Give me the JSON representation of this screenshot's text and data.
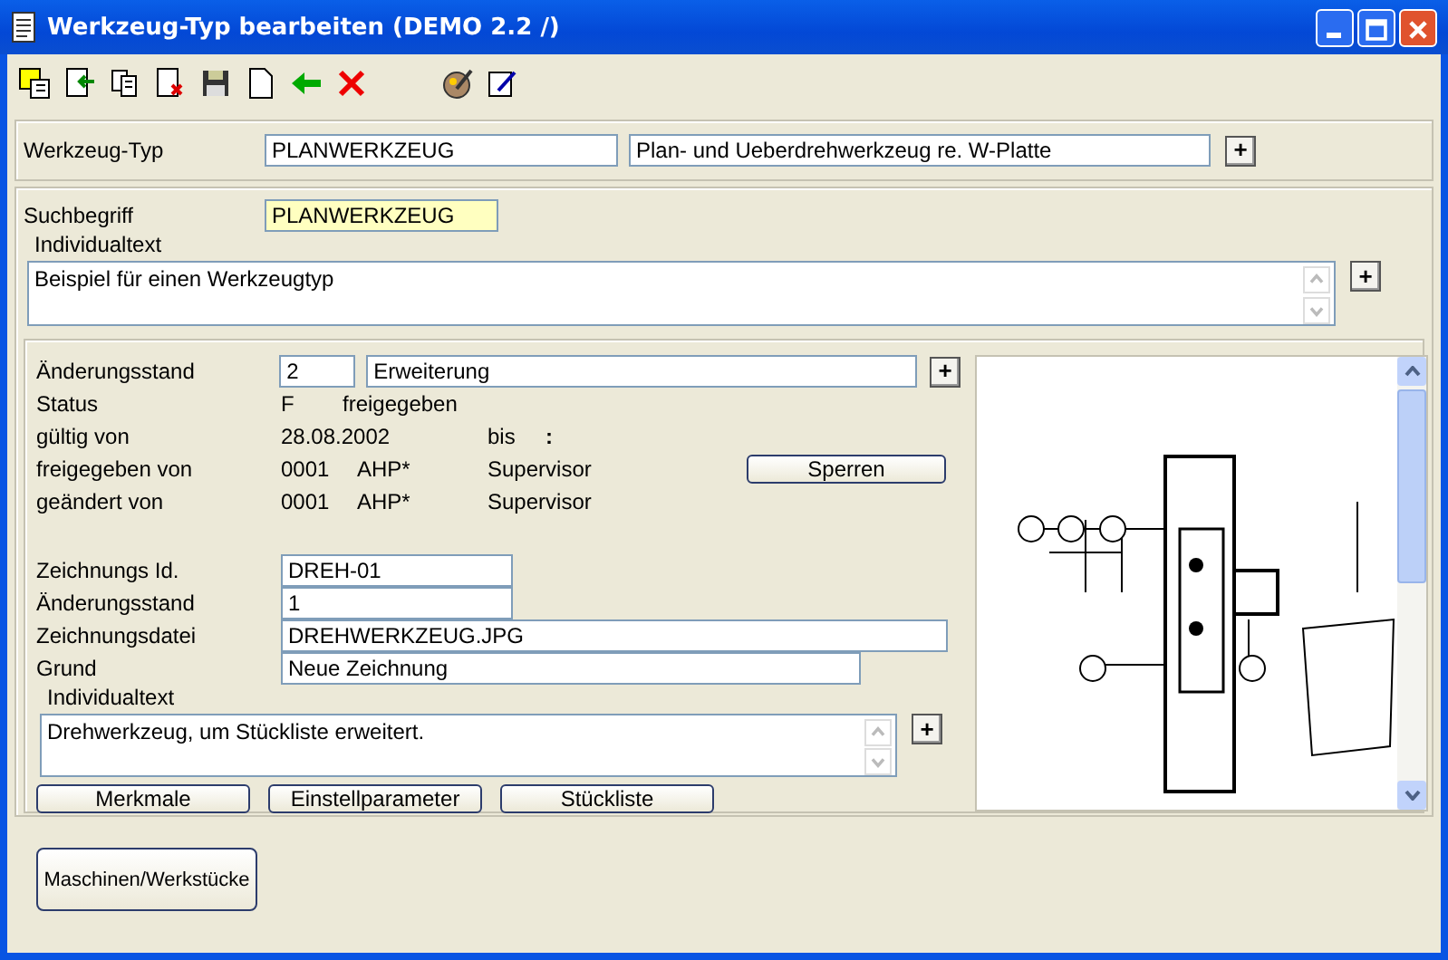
{
  "window": {
    "title": "Werkzeug-Typ bearbeiten (DEMO 2.2 /)"
  },
  "header": {
    "label": "Werkzeug-Typ",
    "code": "PLANWERKZEUG",
    "description": "Plan- und Ueberdrehwerkzeug re. W-Platte",
    "button": "+"
  },
  "search": {
    "label": "Suchbegriff",
    "value": "PLANWERKZEUG",
    "text_label": "Individualtext",
    "text": "Beispiel für einen Werkzeugtyp",
    "button": "+"
  },
  "revision": {
    "label": "Änderungsstand",
    "number": "2",
    "name": "Erweiterung",
    "button": "+",
    "status": {
      "label": "Status",
      "code": "F",
      "text": "freigegeben"
    },
    "valid": {
      "label": "gültig von",
      "from": "28.08.2002",
      "to_label": "bis",
      "to": ":"
    },
    "released": {
      "label": "freigegeben von",
      "id": "0001",
      "user": "AHP*",
      "role": "Supervisor",
      "button": "Sperren"
    },
    "changed": {
      "label": "geändert von",
      "id": "0001",
      "user": "AHP*",
      "role": "Supervisor"
    }
  },
  "drawing_fields": [
    {
      "label": "Zeichnungs Id.",
      "value": "DREH-01",
      "kind": "short"
    },
    {
      "label": "Änderungsstand",
      "value": "1",
      "kind": "short"
    },
    {
      "label": "Zeichnungsdatei",
      "value": "DREHWERKZEUG.JPG",
      "kind": "long"
    },
    {
      "label": "Grund",
      "value": "Neue Zeichnung",
      "kind": "medium"
    }
  ],
  "drawing_text": {
    "label": "Individualtext",
    "text": "Drehwerkzeug, um Stückliste erweitert.",
    "button": "+"
  },
  "buttons": [
    "Merkmale",
    "Einstellparameter",
    "Stückliste"
  ],
  "footer_button": "Maschinen/Werkstücke"
}
